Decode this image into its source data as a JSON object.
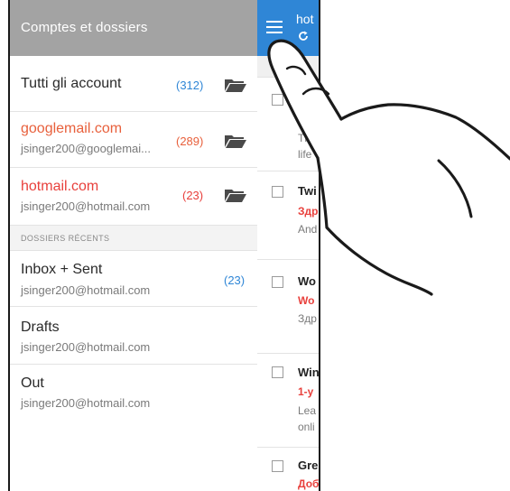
{
  "drawer": {
    "title": "Comptes et dossiers",
    "accounts": [
      {
        "name": "Tutti gli account",
        "email": "",
        "count": "(312)",
        "name_color": "#2a2a2a",
        "count_color": "#2f86d6"
      },
      {
        "name": "googlemail.com",
        "email": "jsinger200@googlemai...",
        "count": "(289)",
        "name_color": "#e8603c",
        "count_color": "#e8603c"
      },
      {
        "name": "hotmail.com",
        "email": "jsinger200@hotmail.com",
        "count": "(23)",
        "name_color": "#e8403c",
        "count_color": "#e8403c"
      }
    ],
    "recent_title": "DOSSIERS RÉCENTS",
    "recent": [
      {
        "name": "Inbox + Sent",
        "email": "jsinger200@hotmail.com",
        "count": "(23)"
      },
      {
        "name": "Drafts",
        "email": "jsinger200@hotmail.com"
      },
      {
        "name": "Out",
        "email": "jsinger200@hotmail.com"
      }
    ]
  },
  "inbox": {
    "title": "hot",
    "messages": [
      {
        "line1": "",
        "line2": "W",
        "line3": "Th",
        "line4": "life"
      },
      {
        "line1": "Twi",
        "line2": "Здр",
        "line3": "And",
        "line4": ""
      },
      {
        "line1": "Wo",
        "line2": "Wo",
        "line3": "Здр",
        "line4": ""
      },
      {
        "line1": "Win",
        "line2": "1-y",
        "line3": "Lea",
        "line4": "onli"
      },
      {
        "line1": "Gre",
        "line2": "Доб",
        "line3": "",
        "line4": ""
      }
    ]
  },
  "colors": {
    "drawer_header": "#a3a3a3",
    "inbox_bar": "#2f86d6",
    "accent_blue": "#2f86d6",
    "accent_red": "#e8403c",
    "accent_orange": "#e8603c"
  },
  "icons": {
    "menu": "hamburger-icon",
    "sync": "sync-icon",
    "folder": "folder-icon",
    "checkbox": "checkbox-icon",
    "hand": "pointing-hand-illustration"
  }
}
